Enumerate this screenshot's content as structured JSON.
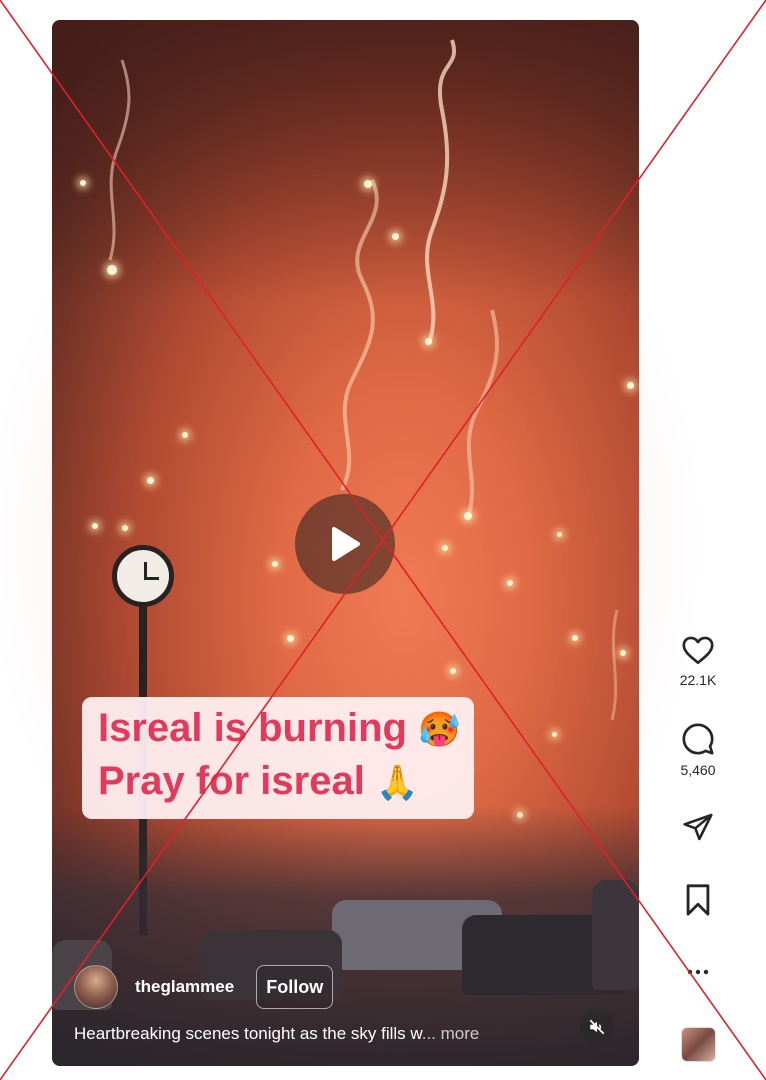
{
  "post": {
    "overlay_caption": {
      "line1": "Isreal is burning",
      "line1_emoji": "🥵",
      "line2": "Pray for isreal",
      "line2_emoji": "🙏"
    },
    "author": {
      "username": "theglammee",
      "follow_label": "Follow"
    },
    "description": "Heartbreaking scenes tonight as the sky fills w",
    "more_label": "... more",
    "play_icon": "play-icon",
    "mute_icon": "muted-speaker-icon"
  },
  "actions": {
    "likes": "22.1K",
    "comments": "5,460"
  },
  "colors": {
    "caption_text": "#e23a5c",
    "caption_bg": "#fff0f2",
    "cross_mark": "#e0202a",
    "rail_icon": "#262626"
  }
}
